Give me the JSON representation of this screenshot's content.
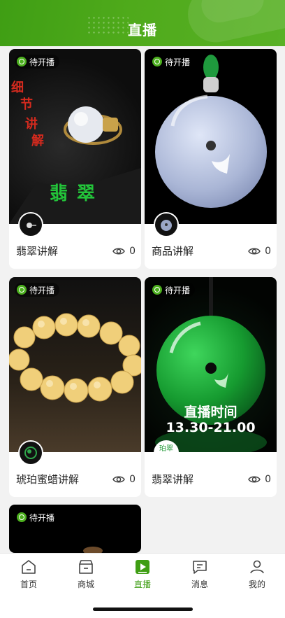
{
  "header": {
    "title": "直播"
  },
  "badge_label": "待开播",
  "cards": [
    {
      "name": "翡翠讲解",
      "views": "0",
      "overlay_lines": [
        "细",
        "节",
        "讲",
        "解"
      ],
      "overlay_caption": "翡 翠"
    },
    {
      "name": "商品讲解",
      "views": "0"
    },
    {
      "name": "琥珀蜜蜡讲解",
      "views": "0"
    },
    {
      "name": "翡翠讲解",
      "views": "0",
      "overlay_title": "直播时间",
      "overlay_time": "13.30-21.00",
      "avatar_text": "珀翠"
    },
    {
      "name": "",
      "views": ""
    }
  ],
  "tabs": [
    {
      "label": "首页",
      "icon": "home-icon"
    },
    {
      "label": "商城",
      "icon": "shop-icon"
    },
    {
      "label": "直播",
      "icon": "live-play-icon",
      "active": true
    },
    {
      "label": "消息",
      "icon": "message-icon"
    },
    {
      "label": "我的",
      "icon": "profile-icon"
    }
  ],
  "colors": {
    "brand": "#4caf1e",
    "active_tab": "#3f9e14"
  }
}
